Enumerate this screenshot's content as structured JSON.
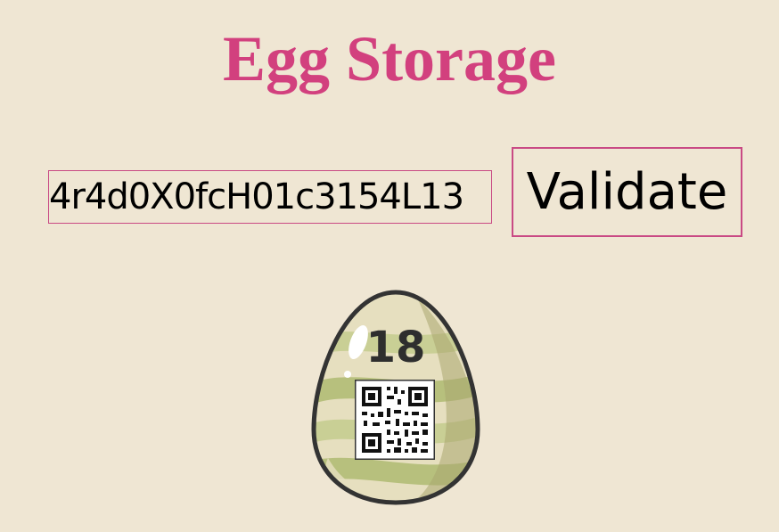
{
  "page": {
    "title": "Egg Storage"
  },
  "form": {
    "code_value": "4r4d0X0fcH01c3154L13",
    "validate_label": "Validate"
  },
  "egg": {
    "number": "18",
    "image": "egg-with-qr-code-icon"
  },
  "colors": {
    "background": "#efe6d3",
    "accent": "#d2407e",
    "border": "#c94a84"
  }
}
